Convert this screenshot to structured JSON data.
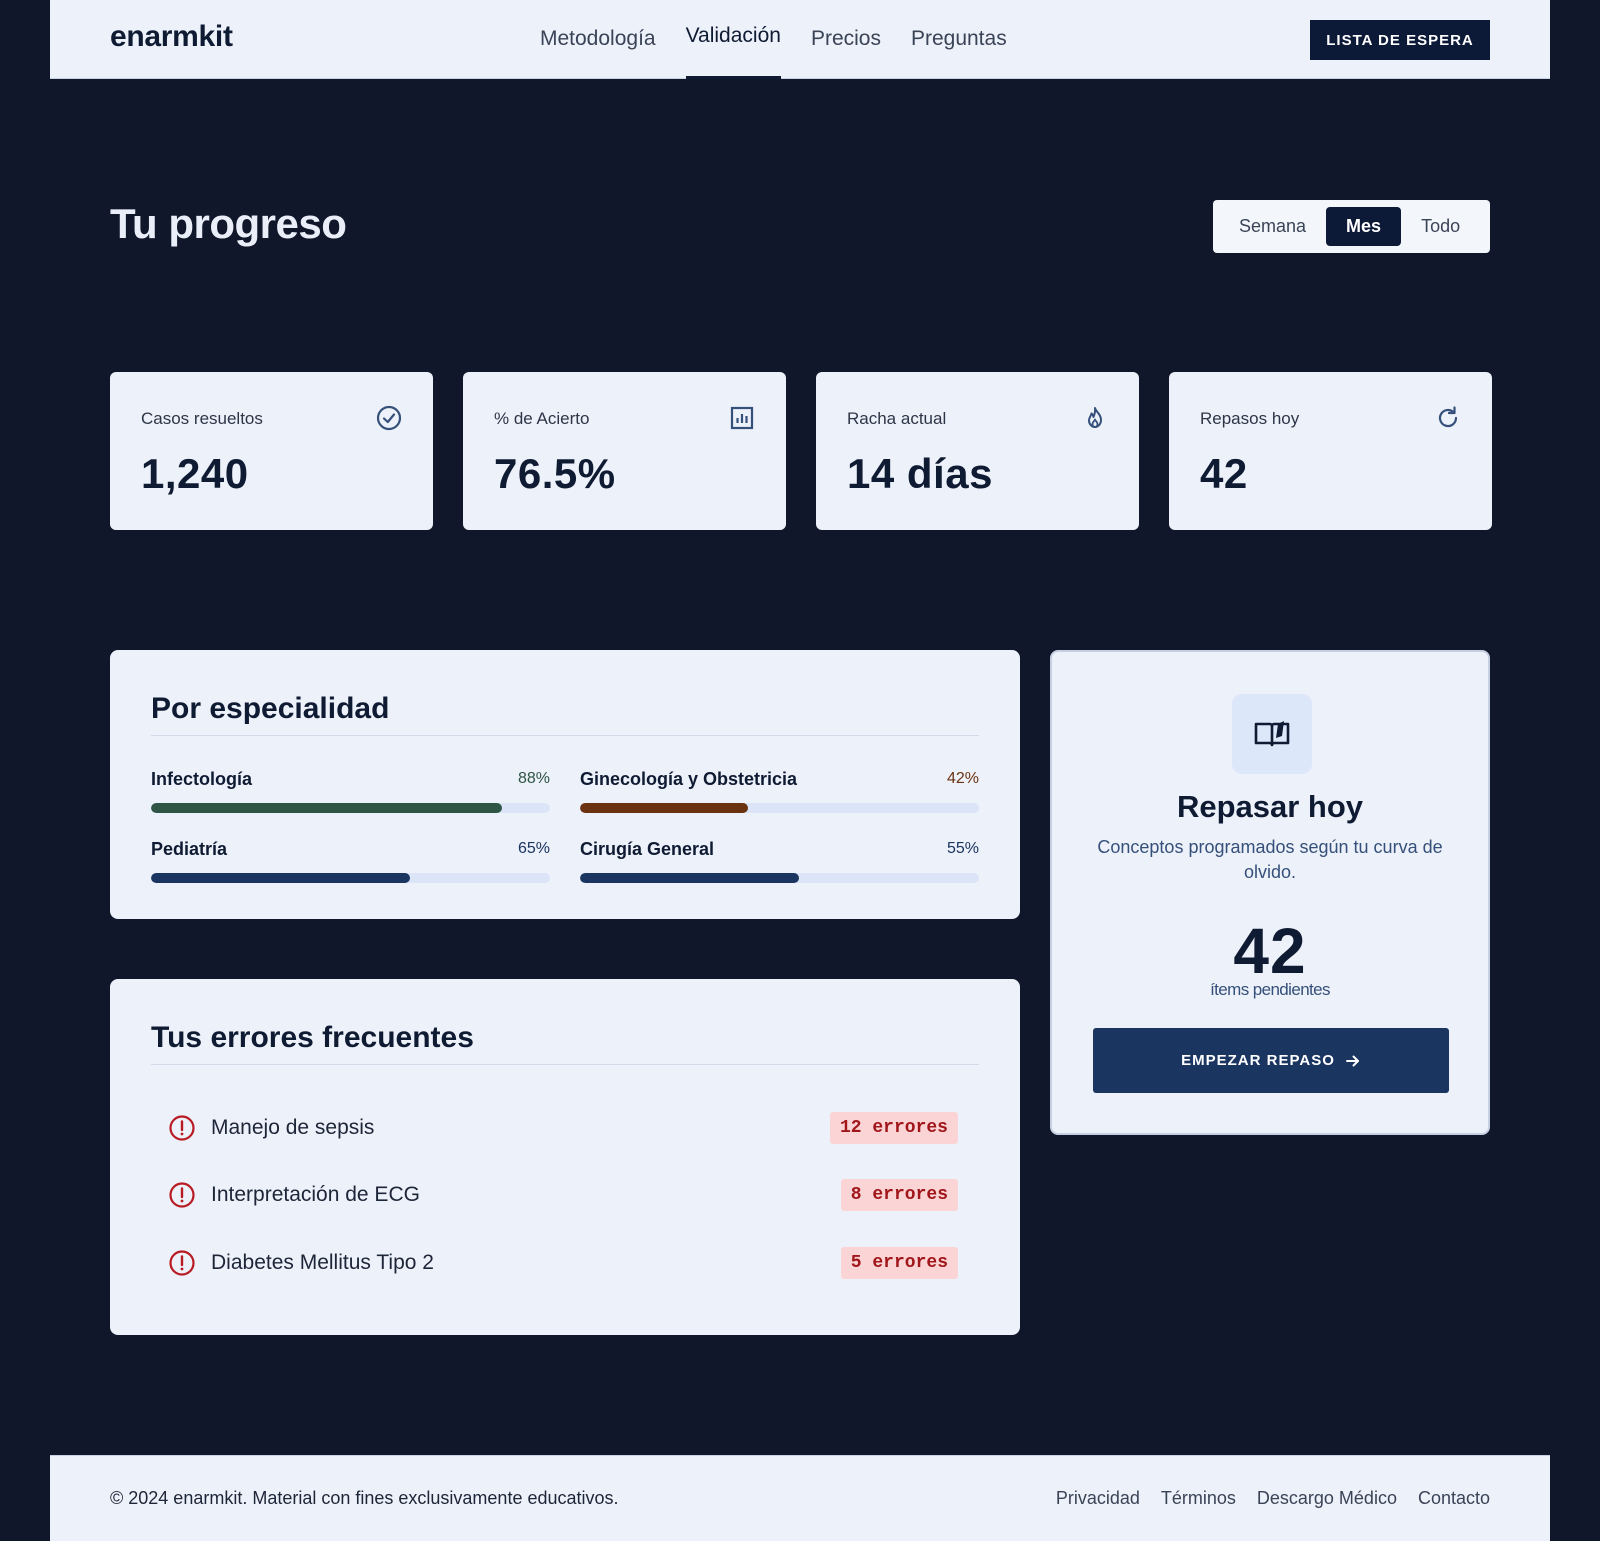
{
  "header": {
    "logo": "enarmkit",
    "nav": [
      {
        "label": "Metodología"
      },
      {
        "label": "Validación"
      },
      {
        "label": "Precios"
      },
      {
        "label": "Preguntas"
      }
    ],
    "active_nav": "Validación",
    "cta": "LISTA DE ESPERA"
  },
  "page_title": "Tu progreso",
  "period": {
    "options": [
      "Semana",
      "Mes",
      "Todo"
    ],
    "selected": "Mes"
  },
  "stats": [
    {
      "label": "Casos resueltos",
      "value": "1,240",
      "icon": "check-circle-icon"
    },
    {
      "label": "% de Acierto",
      "value": "76.5%",
      "icon": "bar-chart-icon"
    },
    {
      "label": "Racha actual",
      "value": "14 días",
      "icon": "flame-icon"
    },
    {
      "label": "Repasos hoy",
      "value": "42",
      "icon": "refresh-icon"
    }
  ],
  "specialty": {
    "title": "Por especialidad",
    "items": [
      {
        "name": "Infectología",
        "percent_label": "88%",
        "value": 88,
        "color": "#2f5546",
        "pct_color": "#2f5546"
      },
      {
        "name": "Ginecología y Obstetricia",
        "percent_label": "42%",
        "value": 42,
        "color": "#6b3210",
        "pct_color": "#6b3210"
      },
      {
        "name": "Pediatría",
        "percent_label": "65%",
        "value": 65,
        "color": "#1b3561",
        "pct_color": "#1b3561"
      },
      {
        "name": "Cirugía General",
        "percent_label": "55%",
        "value": 55,
        "color": "#1b3561",
        "pct_color": "#1b3561"
      }
    ]
  },
  "errors": {
    "title": "Tus errores frecuentes",
    "items": [
      {
        "topic": "Manejo de sepsis",
        "count": "12 errores"
      },
      {
        "topic": "Interpretación de ECG",
        "count": "8 errores"
      },
      {
        "topic": "Diabetes Mellitus Tipo 2",
        "count": "5 errores"
      }
    ]
  },
  "review": {
    "icon": "open-book-icon",
    "title": "Repasar hoy",
    "description": "Conceptos programados según tu curva de olvido.",
    "count": "42",
    "count_label": "ítems pendientes",
    "button": "EMPEZAR REPASO"
  },
  "footer": {
    "copyright": "© 2024 enarmkit. Material con fines exclusivamente educativos.",
    "links": [
      "Privacidad",
      "Términos",
      "Descargo Médico",
      "Contacto"
    ]
  },
  "colors": {
    "background": "#10172a",
    "surface": "#edf1f9",
    "primary": "#0c1a38",
    "button_primary": "#1b3561",
    "error": "#a0161b",
    "error_badge_bg": "#fbd5d5"
  }
}
